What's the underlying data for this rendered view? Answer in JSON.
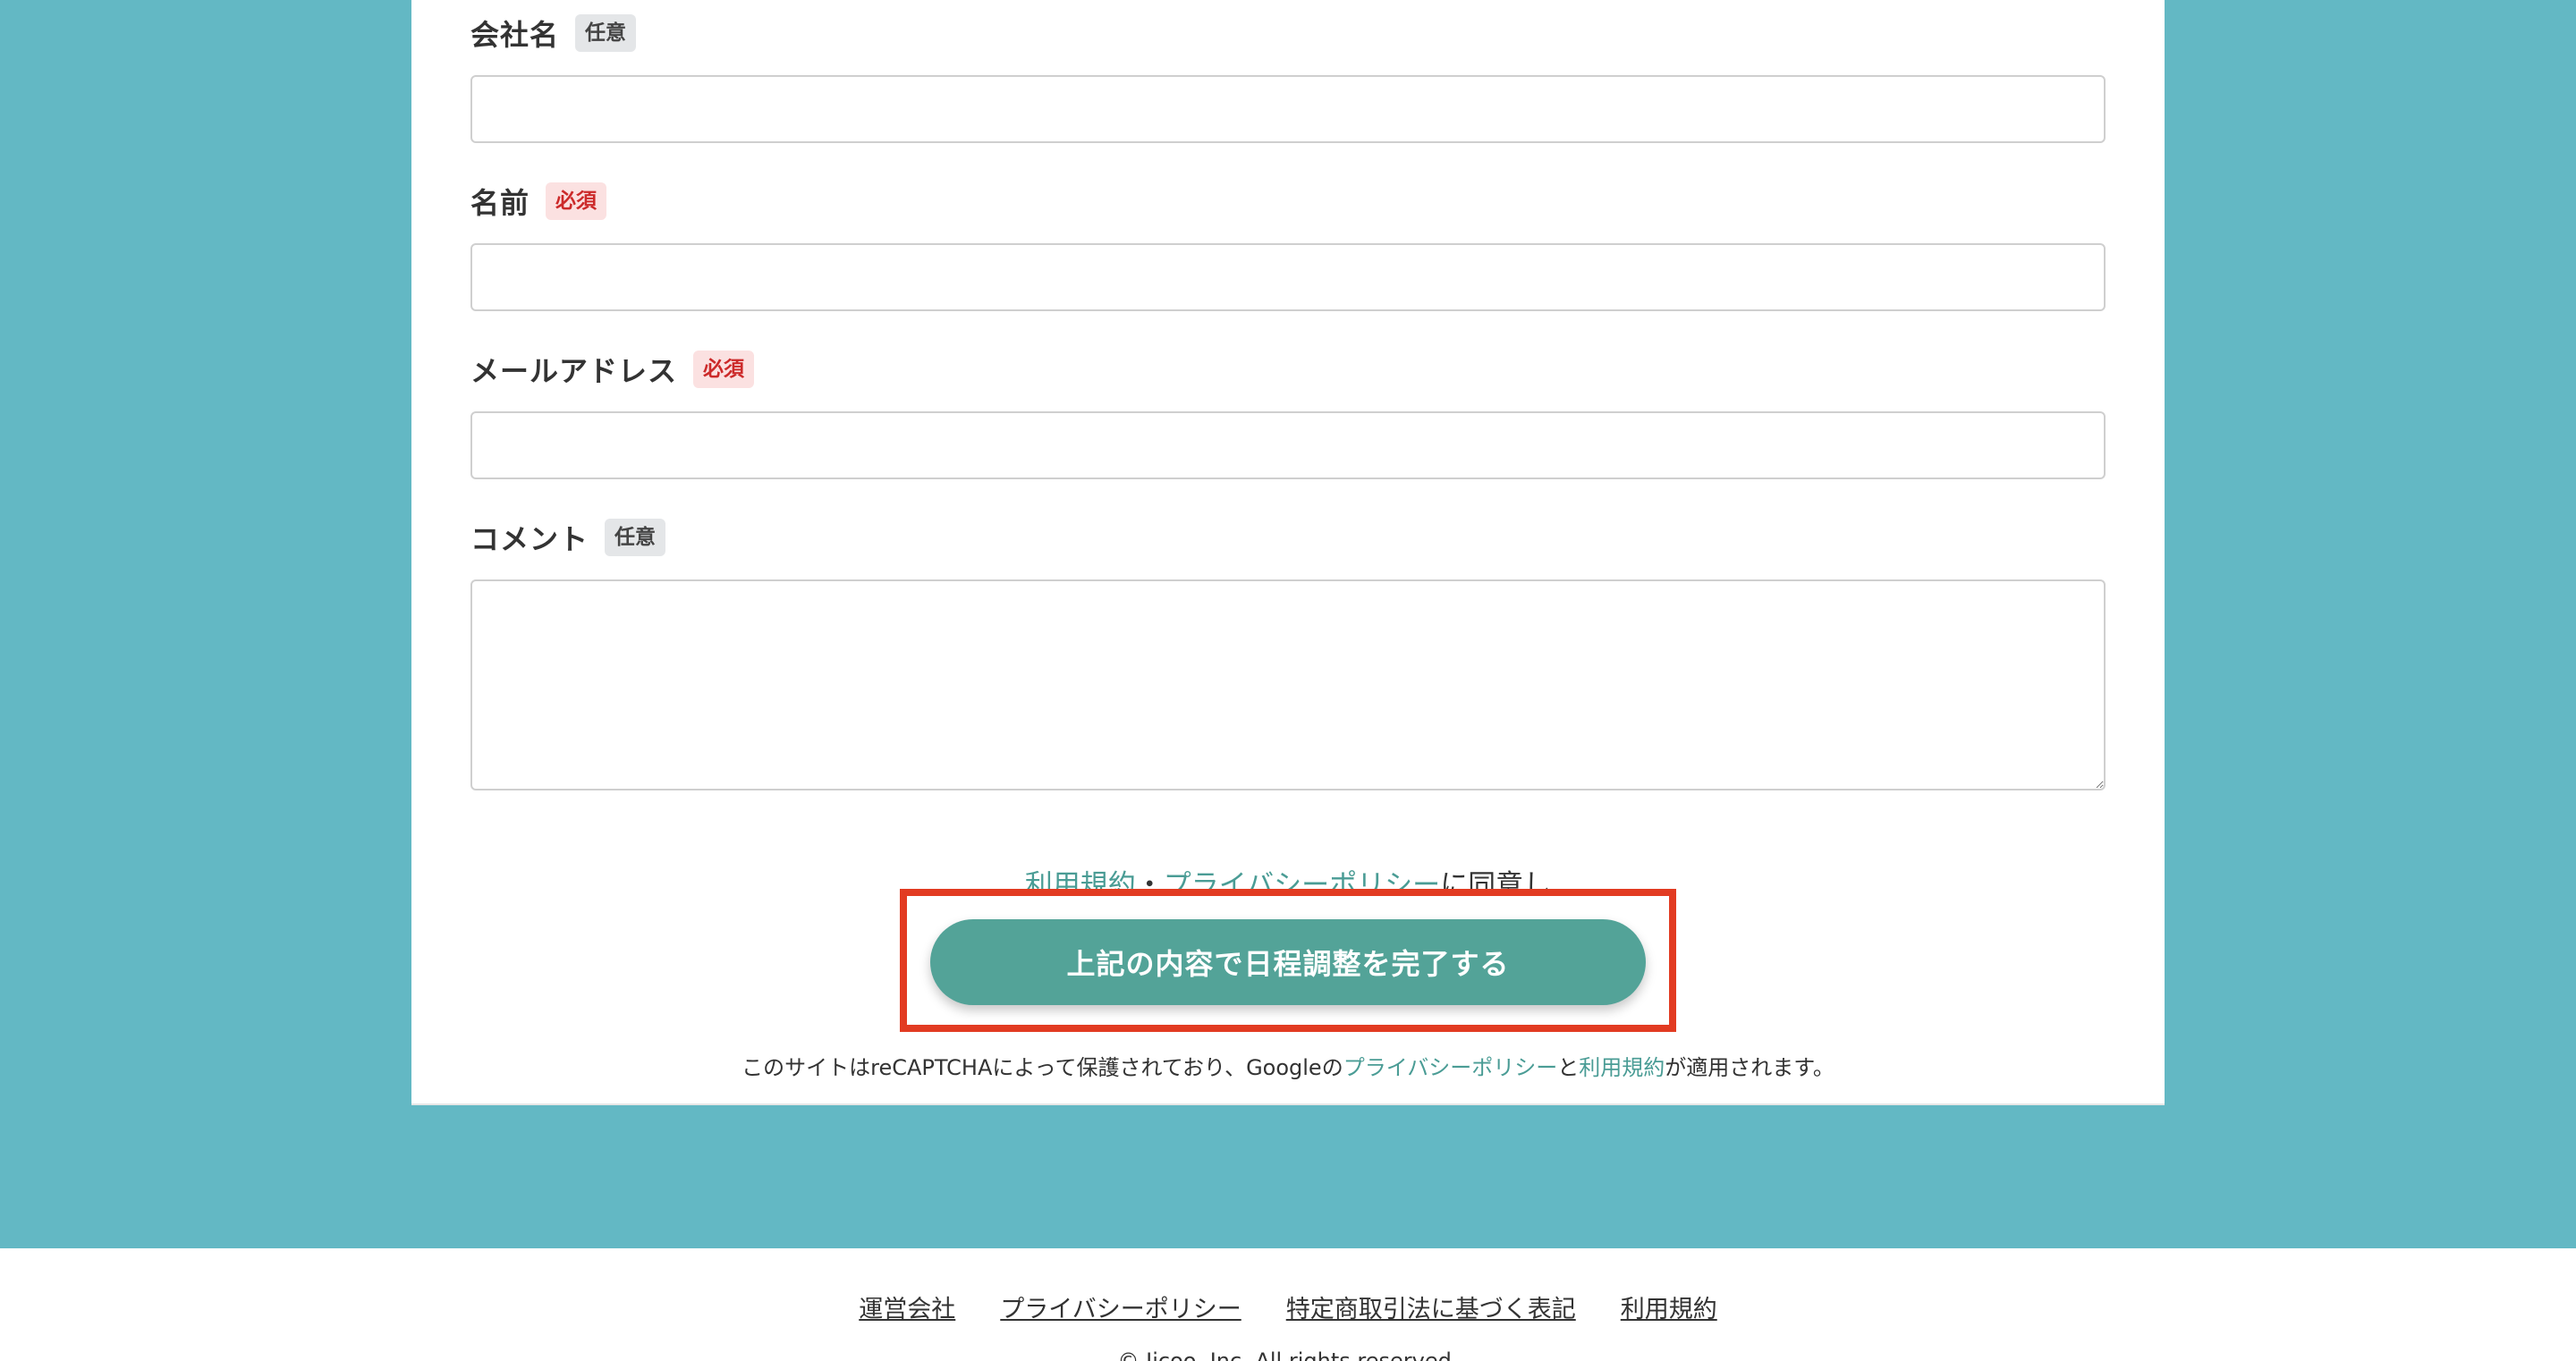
{
  "form": {
    "company": {
      "label": "会社名",
      "badge": "任意",
      "value": ""
    },
    "name": {
      "label": "名前",
      "badge": "必須",
      "value": ""
    },
    "email": {
      "label": "メールアドレス",
      "badge": "必須",
      "value": ""
    },
    "comment": {
      "label": "コメント",
      "badge": "任意",
      "value": ""
    }
  },
  "agreement": {
    "terms_link": "利用規約",
    "separator": "・",
    "privacy_link": "プライバシーポリシー",
    "suffix": "に同意し"
  },
  "submit_label": "上記の内容で日程調整を完了する",
  "recaptcha": {
    "prefix": "このサイトはreCAPTCHAによって保護されており、Googleの",
    "privacy_link": "プライバシーポリシー",
    "middle": "と",
    "terms_link": "利用規約",
    "suffix": "が適用されます。"
  },
  "footer": {
    "links": [
      "運営会社",
      "プライバシーポリシー",
      "特定商取引法に基づく表記",
      "利用規約"
    ],
    "copyright": "© Jicoo, Inc. All rights reserved."
  },
  "colors": {
    "background": "#63b8c4",
    "accent": "#53a398",
    "link": "#4a9c95",
    "required_badge": "#cc2a2a",
    "highlight": "#e23b22"
  }
}
